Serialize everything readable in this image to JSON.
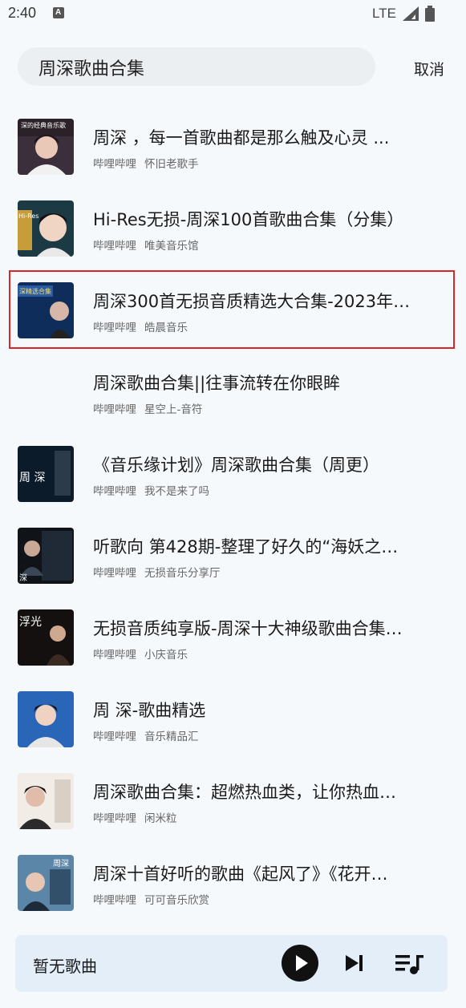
{
  "status": {
    "time": "2:40",
    "network": "LTE"
  },
  "search": {
    "query": "周深歌曲合集",
    "cancel_label": "取消"
  },
  "results": [
    {
      "title": "周深 ，每一首歌曲都是那么触及心灵 ...",
      "source": "哔哩哔哩",
      "author": "怀旧老歌手",
      "thumb_text": "深的经典音乐歌"
    },
    {
      "title": "Hi-Res无损-周深100首歌曲合集（分集）",
      "source": "哔哩哔哩",
      "author": "唯美音乐馆",
      "thumb_text": "Hi-Res"
    },
    {
      "title": "周深300首无损音质精选大合集-2023年…",
      "source": "哔哩哔哩",
      "author": "皓晨音乐",
      "thumb_text": "深精选合集"
    },
    {
      "title": "周深歌曲合集||往事流转在你眼眸",
      "source": "哔哩哔哩",
      "author": "星空上-音符",
      "thumb_text": ""
    },
    {
      "title": "《音乐缘计划》周深歌曲合集（周更）",
      "source": "哔哩哔哩",
      "author": "我不是来了吗",
      "thumb_text": "周 深"
    },
    {
      "title": "听歌向 第428期-整理了好久的“海妖之…",
      "source": "哔哩哔哩",
      "author": "无损音乐分享厅",
      "thumb_text": "深"
    },
    {
      "title": "无损音质纯享版-周深十大神级歌曲合集…",
      "source": "哔哩哔哩",
      "author": "小庆音乐",
      "thumb_text": "浮光"
    },
    {
      "title": "周 深-歌曲精选",
      "source": "哔哩哔哩",
      "author": "音乐精品汇",
      "thumb_text": ""
    },
    {
      "title": "周深歌曲合集：超燃热血类，让你热血…",
      "source": "哔哩哔哩",
      "author": "闲米粒",
      "thumb_text": ""
    },
    {
      "title": "周深十首好听的歌曲《起风了》《花开…",
      "source": "哔哩哔哩",
      "author": "可可音乐欣赏",
      "thumb_text": "周深"
    }
  ],
  "player": {
    "now_playing": "暂无歌曲"
  },
  "colors": {
    "highlight": "#d9262b",
    "player_bg": "#e3eef9",
    "search_bg": "#eceff2"
  }
}
